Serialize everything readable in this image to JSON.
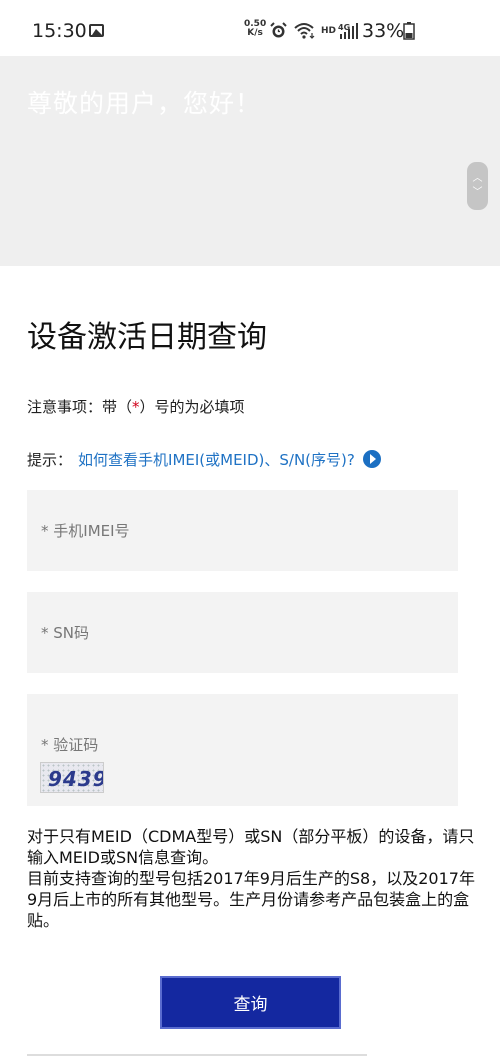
{
  "status_bar": {
    "time": "15:30",
    "net_speed_value": "0.50",
    "net_speed_unit": "K/s",
    "hd_label": "HD",
    "network_label": "4G",
    "battery_percent": "33%"
  },
  "hero": {
    "greeting": "尊敬的用户，您好！",
    "scroll_up": "︿",
    "scroll_down": "﹀"
  },
  "page": {
    "title": "设备激活日期查询",
    "notice_prefix": "注意事项：带（",
    "notice_star": "*",
    "notice_suffix": "）号的为必填项",
    "hint_label": "提示：",
    "hint_link": "如何查看手机IMEI(或MEID)、S/N(序号)?"
  },
  "form": {
    "imei_placeholder": "* 手机IMEI号",
    "sn_placeholder": "* SN码",
    "captcha_label": "* 验证码",
    "captcha_code": "9439",
    "submit_label": "查询"
  },
  "info": {
    "line1": "对于只有MEID（CDMA型号）或SN（部分平板）的设备，请只输入MEID或SN信息查询。",
    "line2": "目前支持查询的型号包括2017年9月后生产的S8，以及2017年9月后上市的所有其他型号。生产月份请参考产品包装盒上的盒贴。"
  },
  "colors": {
    "button_bg": "#1428a0",
    "link": "#1f72c4",
    "required_star": "#d0021b",
    "field_bg": "#f3f3f3",
    "hero_bg": "#efefef"
  },
  "icons": [
    "gallery-icon",
    "alarm-icon",
    "wifi-icon",
    "signal-icon",
    "battery-icon",
    "play-icon",
    "scroll-toggle-icon"
  ]
}
